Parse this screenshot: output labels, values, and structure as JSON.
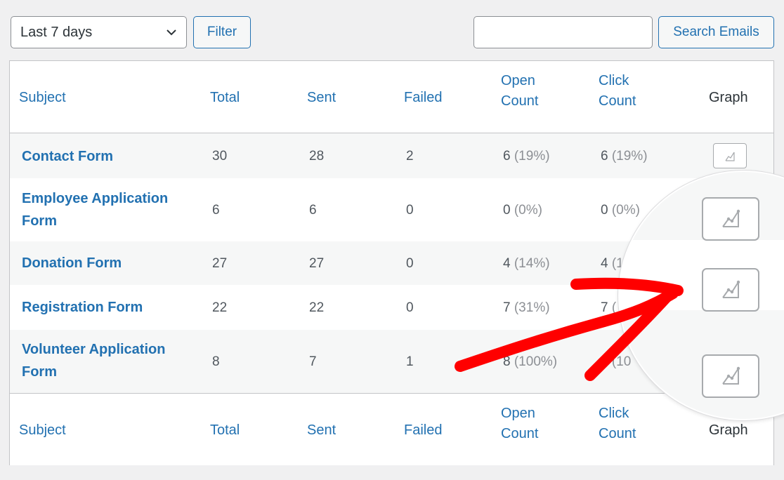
{
  "toolbar": {
    "date_range": "Last 7 days",
    "filter_label": "Filter",
    "search_value": "",
    "search_placeholder": "",
    "search_label": "Search Emails"
  },
  "columns": {
    "subject": "Subject",
    "total": "Total",
    "sent": "Sent",
    "failed": "Failed",
    "open_line1": "Open",
    "open_line2": "Count",
    "click_line1": "Click",
    "click_line2": "Count",
    "graph": "Graph"
  },
  "rows": [
    {
      "subject": "Contact Form",
      "total": "30",
      "sent": "28",
      "failed": "2",
      "open": "6",
      "open_pct": "(19%)",
      "click": "6",
      "click_pct": "(19%)"
    },
    {
      "subject_line1": "Employee Application",
      "subject_line2": "Form",
      "total": "6",
      "sent": "6",
      "failed": "0",
      "open": "0",
      "open_pct": "(0%)",
      "click": "0",
      "click_pct": "(0%)"
    },
    {
      "subject": "Donation Form",
      "total": "27",
      "sent": "27",
      "failed": "0",
      "open": "4",
      "open_pct": "(14%)",
      "click": "4",
      "click_pct": "(1"
    },
    {
      "subject": "Registration Form",
      "total": "22",
      "sent": "22",
      "failed": "0",
      "open": "7",
      "open_pct": "(31%)",
      "click": "7",
      "click_pct": "("
    },
    {
      "subject_line1": "Volunteer Application",
      "subject_line2": "Form",
      "total": "8",
      "sent": "7",
      "failed": "1",
      "open": "8",
      "open_pct": "(100%)",
      "click": "8",
      "click_pct": "(10"
    }
  ],
  "colors": {
    "link": "#2271b1",
    "annotation_arrow": "#ff0000"
  }
}
